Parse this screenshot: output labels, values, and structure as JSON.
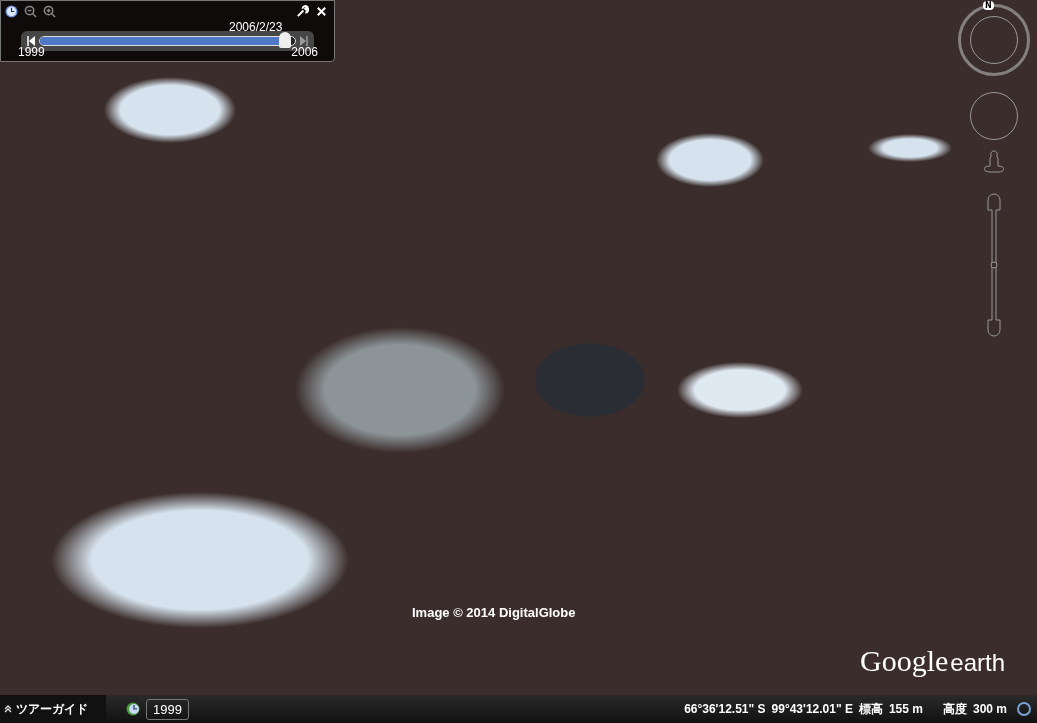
{
  "time_slider": {
    "date": "2006/2/23",
    "start_label": "1999",
    "end_label": "2006",
    "level": 0.96
  },
  "compass": {
    "north": "N"
  },
  "zoom_control": {
    "level": 0.5
  },
  "map": {
    "attribution": "Image © 2014 DigitalGlobe",
    "logo_main": "Google",
    "logo_sub": "earth"
  },
  "status_bar": {
    "tour_guide": "ツアーガイド",
    "historical_year": "1999",
    "latitude": "66°36'12.51\" S",
    "longitude": "99°43'12.01\" E",
    "elevation_label": "標高",
    "elevation": "155 m",
    "altitude_label": "高度",
    "altitude": "300 m"
  }
}
